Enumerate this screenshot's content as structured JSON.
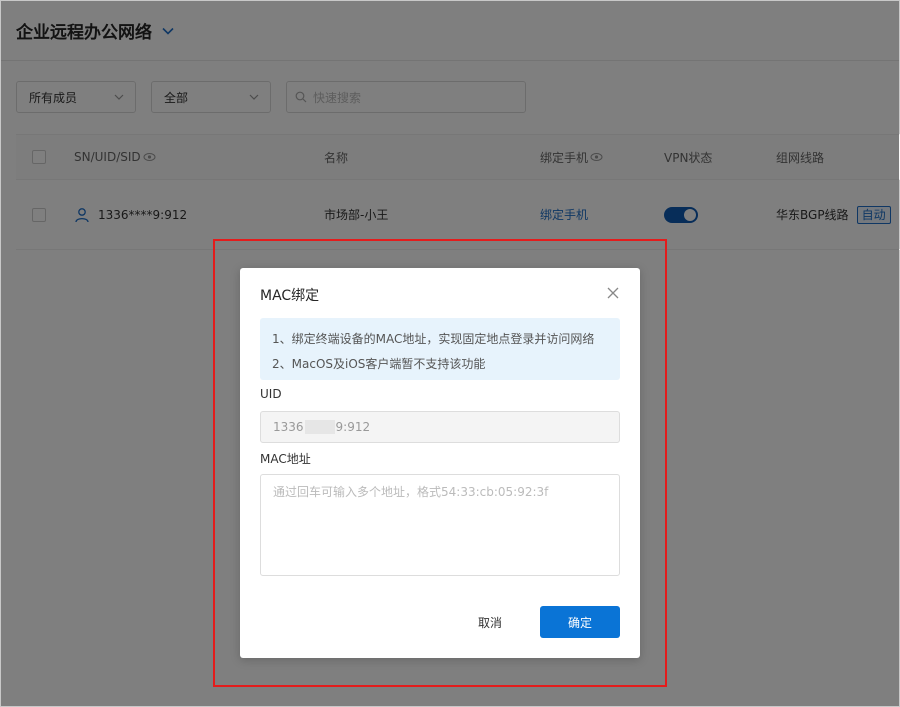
{
  "header": {
    "title": "企业远程办公网络",
    "chevron_icon": "chevron-down-icon"
  },
  "filters": {
    "member_select": "所有成员",
    "status_select": "全部",
    "search_placeholder": "快速搜索"
  },
  "table": {
    "columns": {
      "sn": "SN/UID/SID",
      "name": "名称",
      "phone": "绑定手机",
      "vpn": "VPN状态",
      "route": "组网线路"
    },
    "rows": [
      {
        "sn": "1336****9:912",
        "name": "市场部-小王",
        "phone": "绑定手机",
        "vpn_on": true,
        "route": "华东BGP线路",
        "route_tag": "自动"
      }
    ]
  },
  "dialog": {
    "title": "MAC绑定",
    "notice": [
      "1、绑定终端设备的MAC地址，实现固定地点登录并访问网络",
      "2、MacOS及iOS客户端暂不支持该功能"
    ],
    "uid_label": "UID",
    "uid_prefix": "1336",
    "uid_suffix": "9:912",
    "mac_label": "MAC地址",
    "mac_placeholder": "通过回车可输入多个地址，格式54:33:cb:05:92:3f",
    "cancel_label": "取消",
    "ok_label": "确定"
  },
  "colors": {
    "accent": "#0a74d6",
    "link": "#1e6fc8",
    "highlight_border": "#e41c1c",
    "notice_bg": "#e7f3fc"
  }
}
